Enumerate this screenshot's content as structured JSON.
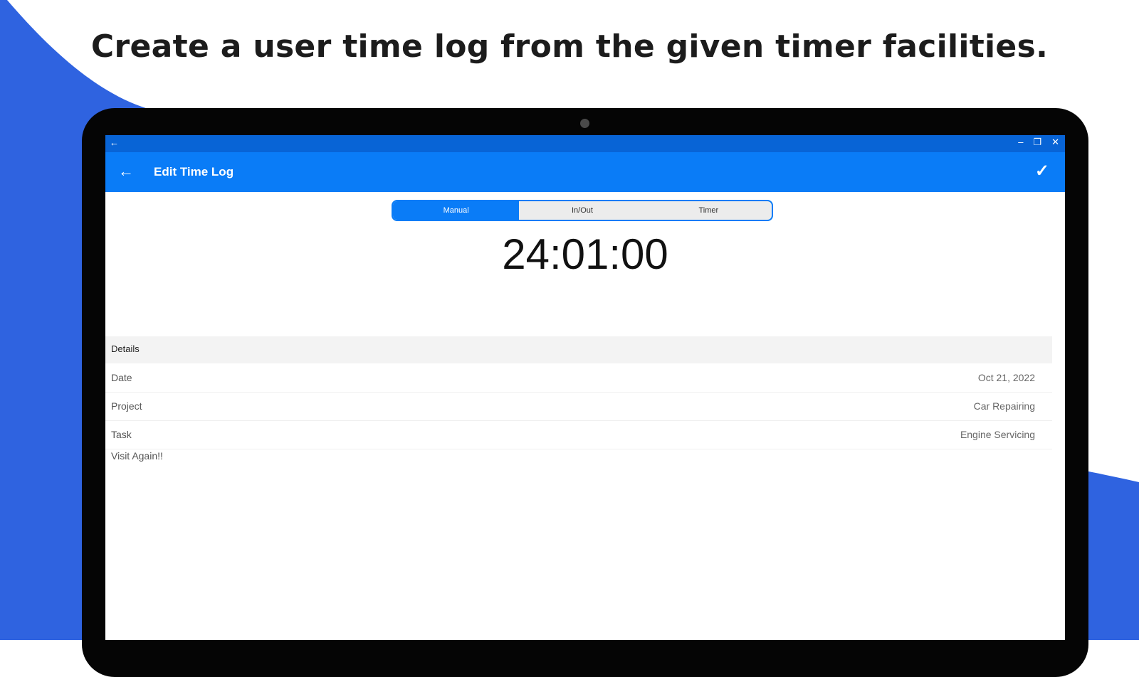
{
  "headline": "Create a user time log from the given timer facilities.",
  "colors": {
    "brand_blue": "#2f63e0",
    "appbar_blue": "#0a7cf7",
    "titlebar_blue": "#0864d6"
  },
  "window": {
    "back_icon": "arrow-left-icon",
    "controls": [
      "minimize-icon",
      "restore-icon",
      "close-icon"
    ]
  },
  "appbar": {
    "title": "Edit Time Log",
    "back_icon": "arrow-left-icon",
    "confirm_icon": "check-icon"
  },
  "segments": [
    {
      "label": "Manual",
      "active": true
    },
    {
      "label": "In/Out",
      "active": false
    },
    {
      "label": "Timer",
      "active": false
    }
  ],
  "time_display": "24:01:00",
  "details": {
    "header": "Details",
    "rows": [
      {
        "label": "Date",
        "value": "Oct 21, 2022"
      },
      {
        "label": "Project",
        "value": "Car Repairing"
      },
      {
        "label": "Task",
        "value": "Engine Servicing"
      }
    ],
    "note": "Visit Again!!"
  }
}
